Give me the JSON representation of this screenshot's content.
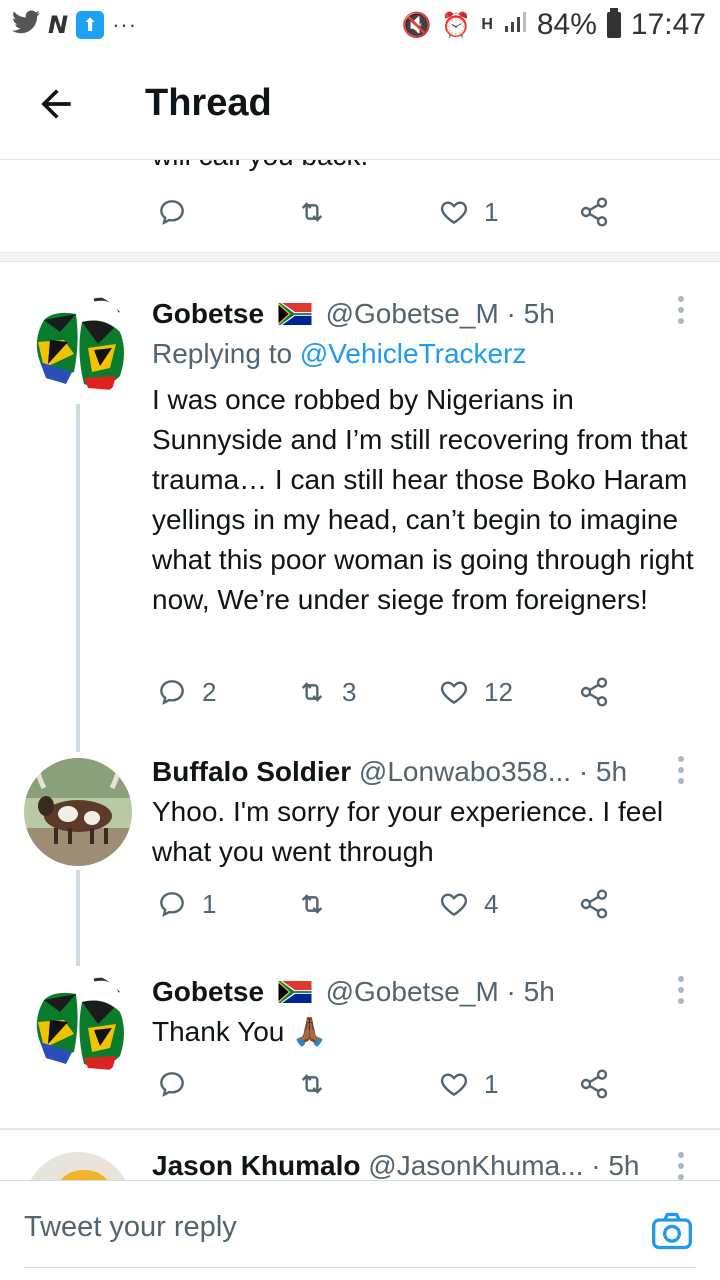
{
  "status_bar": {
    "left_icons": [
      "twitter-bird-icon",
      "n-icon",
      "rocket-app-icon",
      "more-dots"
    ],
    "right_icons": [
      "mute-icon",
      "alarm-icon",
      "h-network-icon",
      "signal-icon"
    ],
    "battery": "84%",
    "time": "17:47"
  },
  "header": {
    "title": "Thread"
  },
  "partial_tweet": {
    "cut_text": "will call you back.",
    "actions": {
      "replies": "",
      "retweets": "",
      "likes": "1"
    }
  },
  "tweets": [
    {
      "name": "Gobetse",
      "handle": "@Gobetse_M",
      "time": "· 5h",
      "replying_prefix": "Replying to ",
      "replying_to": "@VehicleTrackerz",
      "text": "I was once robbed by Nigerians in Sunnyside and I’m still recovering from that trauma… I can still hear those Boko Haram yellings in my head, can’t begin to imagine what this poor woman is going through right now, We’re under siege from foreigners!",
      "actions": {
        "replies": "2",
        "retweets": "3",
        "likes": "12"
      }
    },
    {
      "name": "Buffalo Soldier",
      "handle": "@Lonwabo358...",
      "time": "· 5h",
      "text": "Yhoo. I'm sorry for your experience. I feel what you went through",
      "actions": {
        "replies": "1",
        "retweets": "",
        "likes": "4"
      }
    },
    {
      "name": "Gobetse",
      "handle": "@Gobetse_M",
      "time": "· 5h",
      "text": "Thank You 🙏🏾",
      "actions": {
        "replies": "",
        "retweets": "",
        "likes": "1"
      }
    },
    {
      "name": "Jason Khumalo",
      "handle": "@JasonKhuma...",
      "time": "· 5h"
    }
  ],
  "compose": {
    "placeholder": "Tweet your reply"
  },
  "colors": {
    "accent": "#1d9bf0",
    "secondary_text": "#536471",
    "thread_line": "#cfd9de"
  }
}
